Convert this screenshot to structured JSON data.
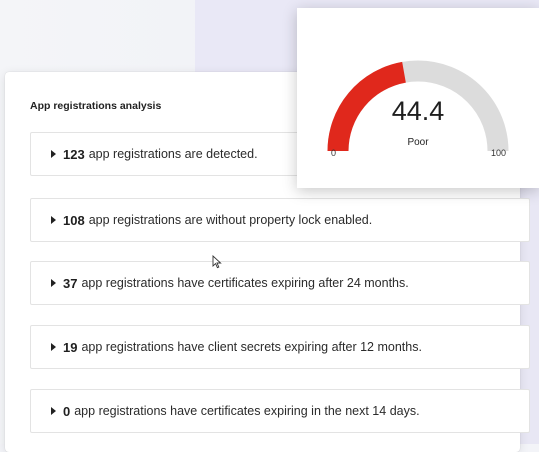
{
  "analysis": {
    "title": "App registrations analysis",
    "items": [
      {
        "count": "123",
        "text": "app registrations are detected."
      },
      {
        "count": "108",
        "text": "app registrations are without property lock enabled."
      },
      {
        "count": "37",
        "text": "app registrations have certificates expiring after 24 months."
      },
      {
        "count": "19",
        "text": "app registrations have client secrets expiring after 12 months."
      },
      {
        "count": "0",
        "text": "app registrations have certificates expiring in the next 14 days."
      }
    ]
  },
  "gauge": {
    "value": 44.4,
    "value_text": "44.4",
    "rating": "Poor",
    "min_label": "0",
    "max_label": "100",
    "min": 0,
    "max": 100,
    "fill_color": "#e0281c",
    "track_color": "#dcdcdc"
  },
  "icons": {
    "item_caret": "caret-right-icon",
    "cursor": "mouse-pointer-icon"
  }
}
